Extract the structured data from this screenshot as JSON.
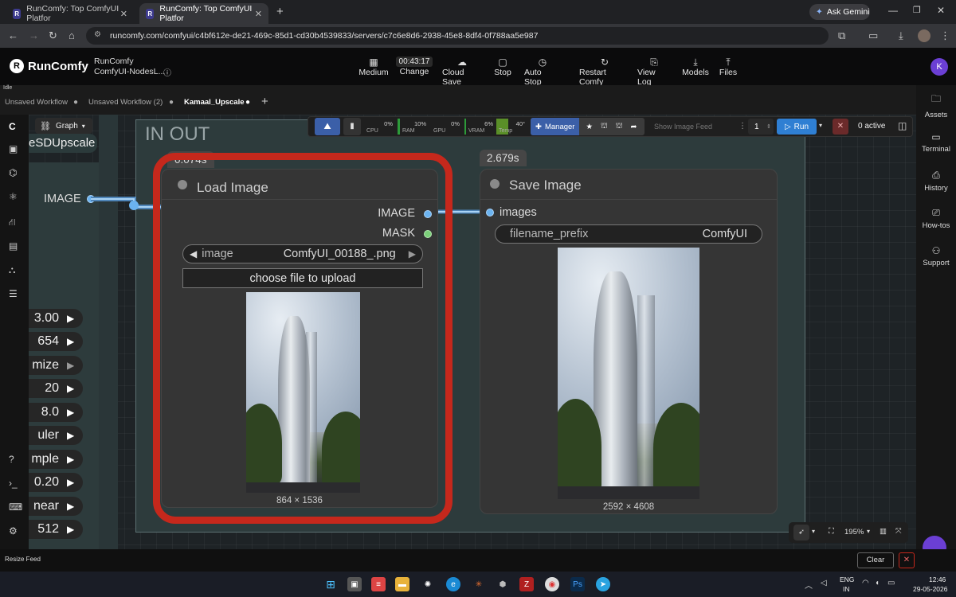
{
  "browser": {
    "tabs": [
      {
        "title": "RunComfy: Top ComfyUI Platfor",
        "active": false
      },
      {
        "title": "RunComfy: Top ComfyUI Platfor",
        "active": true
      }
    ],
    "new_tab": "+",
    "gemini": "Ask Gemini",
    "url": "runcomfy.com/comfyui/c4bf612e-de21-469c-85d1-cd30b4539833/servers/c7c6e8d6-2938-45e8-8df4-0f788aa5e987",
    "profile_initial": ""
  },
  "app": {
    "brand": "RunComfy",
    "project_title": "RunComfy",
    "project_subtitle": "ComfyUI-NodesL...",
    "status_left": "Idle",
    "timer": "00:43:17",
    "header_buttons": [
      {
        "label": "Medium",
        "icon": "gpu-icon"
      },
      {
        "label": "Change",
        "icon": "timer-icon"
      },
      {
        "label": "Cloud Save",
        "icon": "cloud-upload-icon"
      },
      {
        "label": "Stop",
        "icon": "stop-icon"
      },
      {
        "label": "Auto Stop",
        "icon": "clock-icon"
      },
      {
        "label": "Restart Comfy",
        "icon": "restart-icon"
      },
      {
        "label": "View Log",
        "icon": "log-icon"
      },
      {
        "label": "Models",
        "icon": "download-icon"
      },
      {
        "label": "Files",
        "icon": "upload-icon"
      }
    ],
    "avatar_initial": "K"
  },
  "workflow_tabs": [
    {
      "label": "Unsaved Workflow",
      "active": false
    },
    {
      "label": "Unsaved Workflow (2)",
      "active": false
    },
    {
      "label": "Kamaal_Upscale",
      "active": true
    }
  ],
  "add_tab": "+",
  "graph_label": "Graph",
  "toolbar": {
    "meters": [
      {
        "label": "CPU",
        "value": "0%"
      },
      {
        "label": "RAM",
        "value": "10%"
      },
      {
        "label": "GPU",
        "value": "0%"
      },
      {
        "label": "VRAM",
        "value": "6%"
      },
      {
        "label": "Temp",
        "value": "40°"
      }
    ],
    "manager": "Manager",
    "show_feed": "Show Image Feed",
    "batch": "1",
    "run": "Run",
    "active": "0 active"
  },
  "canvas": {
    "group_title": "IN OUT",
    "partial_node_title": "eSDUpscale",
    "partial_output": "IMAGE",
    "partial_values": [
      "3.00",
      "654",
      "mize",
      "20",
      "8.0",
      "uler",
      "mple",
      "0.20",
      "near",
      "512"
    ],
    "load_image": {
      "time": "0.074s",
      "title": "Load Image",
      "outputs": [
        "IMAGE",
        "MASK"
      ],
      "image_label": "image",
      "image_value": "ComfyUI_00188_.png",
      "upload_label": "choose file to upload",
      "dims": "864 × 1536"
    },
    "save_image": {
      "time": "2.679s",
      "title": "Save Image",
      "input": "images",
      "prefix_label": "filename_prefix",
      "prefix_value": "ComfyUI",
      "dims": "2592 × 4608"
    },
    "zoom": "195%"
  },
  "right_sidebar": [
    {
      "label": "Assets",
      "icon": "folder-icon"
    },
    {
      "label": "Terminal",
      "icon": "terminal-icon"
    },
    {
      "label": "History",
      "icon": "history-icon"
    },
    {
      "label": "How-tos",
      "icon": "book-icon"
    },
    {
      "label": "Support",
      "icon": "support-icon"
    }
  ],
  "bottom": {
    "resize_feed": "Resize Feed",
    "clear": "Clear"
  },
  "taskbar": {
    "lang": "ENG",
    "region": "IN",
    "time": "12:46",
    "date": "29-05-2026"
  },
  "colors": {
    "accent_red": "#c5281c",
    "socket_blue": "#6bb3f0",
    "socket_green": "#7cd07a",
    "run_blue": "#2f7fd3"
  }
}
